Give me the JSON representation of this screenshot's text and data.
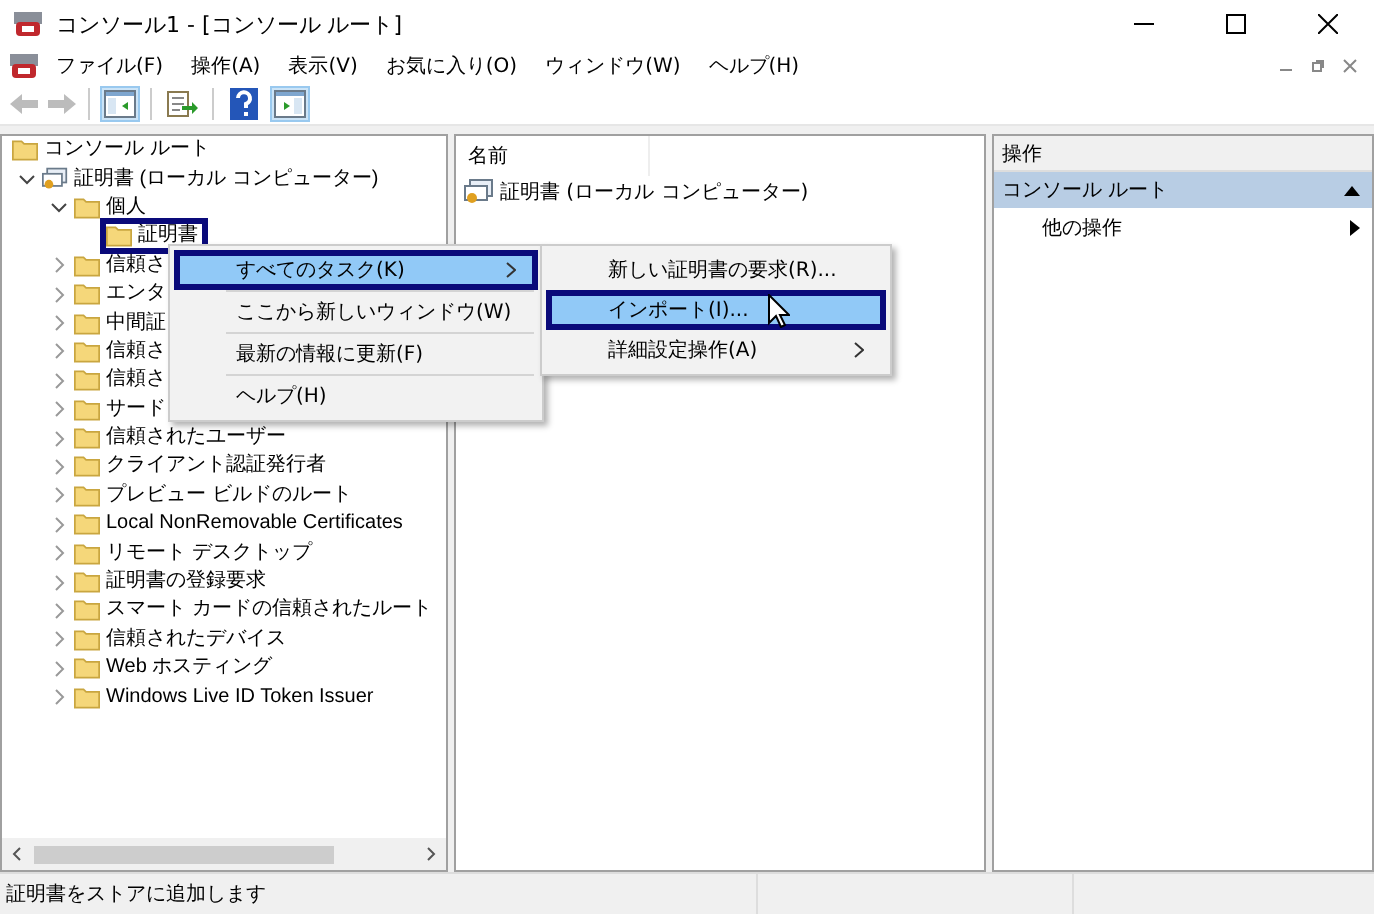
{
  "window": {
    "title": "コンソール1 - [コンソール ルート]"
  },
  "menu_bar": [
    "ファイル(F)",
    "操作(A)",
    "表示(V)",
    "お気に入り(O)",
    "ウィンドウ(W)",
    "ヘルプ(H)"
  ],
  "toolbar": [
    {
      "kind": "back",
      "disabled": true
    },
    {
      "kind": "forward",
      "disabled": true
    },
    {
      "kind": "sep"
    },
    {
      "kind": "tree",
      "selected": true
    },
    {
      "kind": "sep"
    },
    {
      "kind": "export",
      "selected": false
    },
    {
      "kind": "sep"
    },
    {
      "kind": "help",
      "selected": false
    },
    {
      "kind": "pane",
      "selected": true
    }
  ],
  "tree": [
    {
      "label": "コンソール ルート",
      "kind": "folder",
      "selected": false,
      "children": [
        {
          "label": "証明書 (ローカル コンピューター)",
          "kind": "computer",
          "expanded": true,
          "selected": false,
          "children": [
            {
              "label": "個人",
              "kind": "folder",
              "expanded": true,
              "selected": false,
              "children": [
                {
                  "label": "証明書",
                  "kind": "folder",
                  "selected": true
                }
              ]
            },
            {
              "label": "信頼さ",
              "kind": "folder",
              "expanded": false,
              "selected": false
            },
            {
              "label": "エンタ",
              "kind": "folder",
              "expanded": false,
              "selected": false
            },
            {
              "label": "中間証",
              "kind": "folder",
              "expanded": false,
              "selected": false
            },
            {
              "label": "信頼さ",
              "kind": "folder",
              "expanded": false,
              "selected": false
            },
            {
              "label": "信頼さ",
              "kind": "folder",
              "expanded": false,
              "selected": false
            },
            {
              "label": "サード",
              "kind": "folder",
              "expanded": false,
              "selected": false
            },
            {
              "label": "信頼されたユーザー",
              "kind": "folder",
              "expanded": false,
              "selected": false
            },
            {
              "label": "クライアント認証発行者",
              "kind": "folder",
              "expanded": false,
              "selected": false
            },
            {
              "label": "プレビュー ビルドのルート",
              "kind": "folder",
              "expanded": false,
              "selected": false
            },
            {
              "label": "Local NonRemovable Certificates",
              "kind": "folder",
              "expanded": false,
              "selected": false
            },
            {
              "label": "リモート デスクトップ",
              "kind": "folder",
              "expanded": false,
              "selected": false
            },
            {
              "label": "証明書の登録要求",
              "kind": "folder",
              "expanded": false,
              "selected": false
            },
            {
              "label": "スマート カードの信頼されたルート",
              "kind": "folder",
              "expanded": false,
              "selected": false
            },
            {
              "label": "信頼されたデバイス",
              "kind": "folder",
              "expanded": false,
              "selected": false
            },
            {
              "label": "Web ホスティング",
              "kind": "folder",
              "expanded": false,
              "selected": false
            },
            {
              "label": "Windows Live ID Token Issuer",
              "kind": "folder",
              "expanded": false,
              "selected": false
            }
          ]
        }
      ]
    }
  ],
  "list": {
    "column_header": "名前",
    "rows": [
      {
        "label": "証明書 (ローカル コンピューター)"
      }
    ]
  },
  "actions": {
    "header": "操作",
    "section": "コンソール ルート",
    "items": [
      "他の操作"
    ]
  },
  "context_menu": [
    {
      "label": "すべてのタスク(K)",
      "submenu": true,
      "selected": true
    },
    {
      "kind": "sep"
    },
    {
      "label": "ここから新しいウィンドウ(W)",
      "submenu": false,
      "selected": false
    },
    {
      "kind": "sep"
    },
    {
      "label": "最新の情報に更新(F)",
      "submenu": false,
      "selected": false
    },
    {
      "kind": "sep"
    },
    {
      "label": "ヘルプ(H)",
      "submenu": false,
      "selected": false
    }
  ],
  "submenu": [
    {
      "label": "新しい証明書の要求(R)...",
      "submenu": false,
      "selected": false
    },
    {
      "label": "インポート(I)...",
      "submenu": false,
      "selected": true
    },
    {
      "label": "詳細設定操作(A)",
      "submenu": true,
      "selected": false
    }
  ],
  "status_bar": "証明書をストアに追加します"
}
